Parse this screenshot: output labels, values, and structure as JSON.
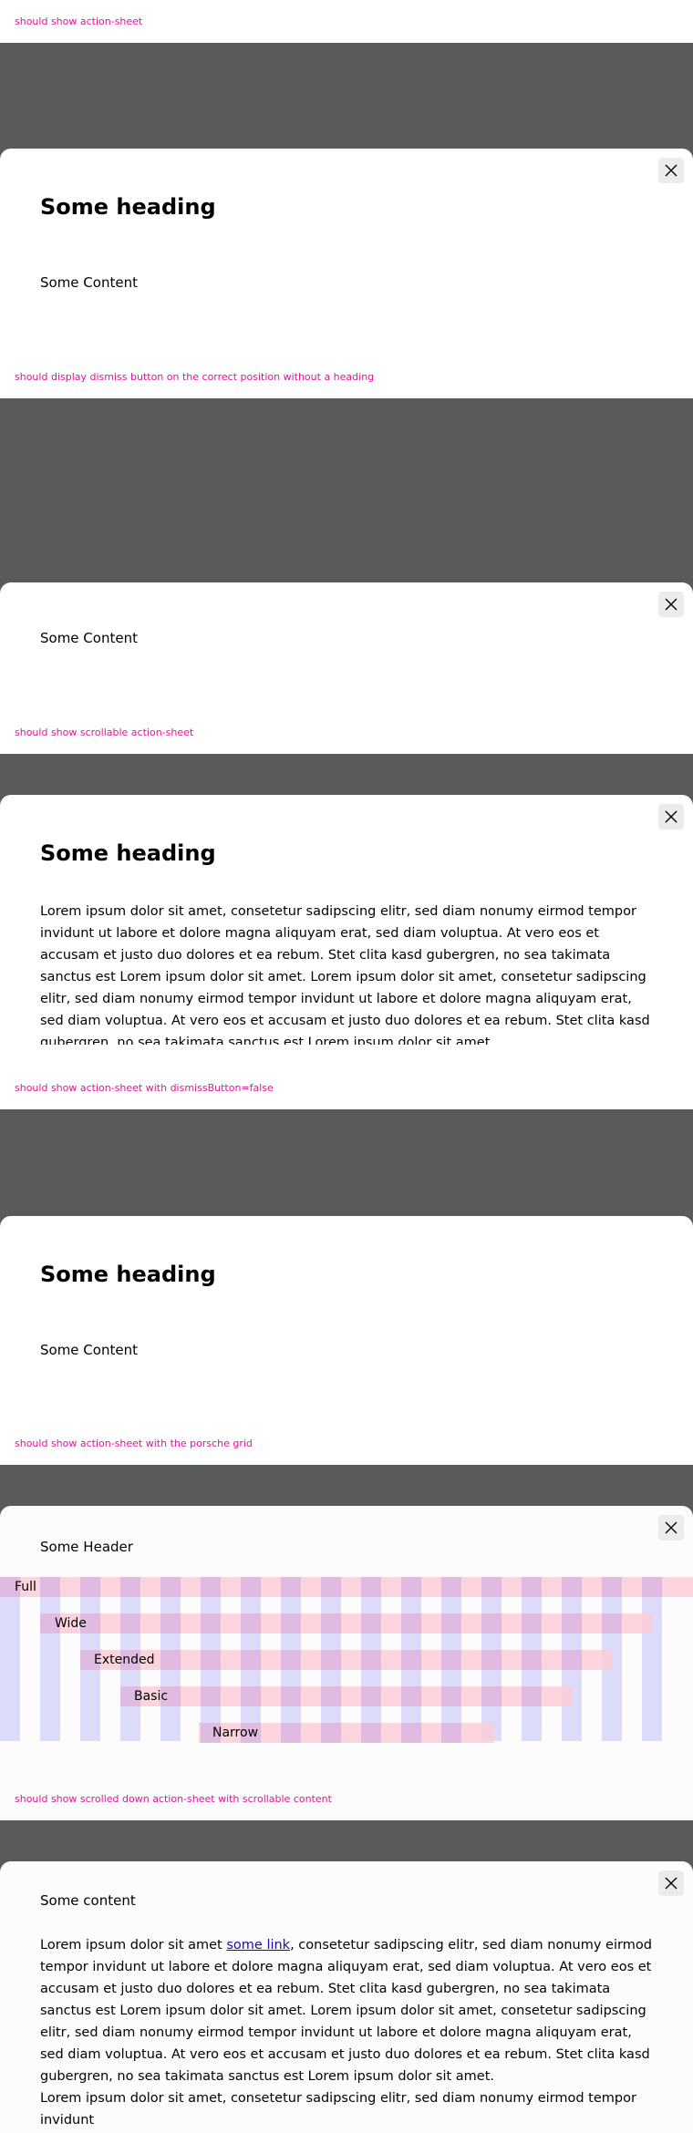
{
  "colors": {
    "label": "#e0149f",
    "backdrop": "#595a5c",
    "sheet": "#ffffff",
    "dismiss_bg": "#ebecee",
    "grid_column": "#dcdcfa",
    "grid_row": "#facdd7"
  },
  "icons": {
    "dismiss": "close-icon"
  },
  "sections": [
    {
      "label": "should show action-sheet",
      "heading": "Some heading",
      "content": "Some Content",
      "dismiss_label": "Dismiss"
    },
    {
      "label": "should display dismiss button on the correct position without a heading",
      "content": "Some Content",
      "dismiss_label": "Dismiss"
    },
    {
      "label": "should show scrollable action-sheet",
      "heading": "Some heading",
      "paragraph": "Lorem ipsum dolor sit amet, consetetur sadipscing elitr, sed diam nonumy eirmod tempor invidunt ut labore et dolore magna aliquyam erat, sed diam voluptua. At vero eos et accusam et justo duo dolores et ea rebum. Stet clita kasd gubergren, no sea takimata sanctus est Lorem ipsum dolor sit amet. Lorem ipsum dolor sit amet, consetetur sadipscing elitr, sed diam nonumy eirmod tempor invidunt ut labore et dolore magna aliquyam erat, sed diam voluptua. At vero eos et accusam et justo duo dolores et ea rebum. Stet clita kasd gubergren, no sea takimata sanctus est Lorem ipsum dolor sit amet.",
      "dismiss_label": "Dismiss"
    },
    {
      "label": "should show action-sheet with dismissButton=false",
      "heading": "Some heading",
      "content": "Some Content"
    },
    {
      "label": "should show action-sheet with the porsche grid",
      "header": "Some Header",
      "grid_rows": [
        "Full",
        "Wide",
        "Extended",
        "Basic",
        "Narrow"
      ],
      "dismiss_label": "Dismiss"
    },
    {
      "label": "should show scrolled down action-sheet with scrollable content",
      "header": "Some content",
      "para1_before": "Lorem ipsum dolor sit amet ",
      "link_text": "some link",
      "para1_after": ", consetetur sadipscing elitr, sed diam nonumy eirmod tempor invidunt ut labore et dolore magna aliquyam erat, sed diam voluptua. At vero eos et accusam et justo duo dolores et ea rebum. Stet clita kasd gubergren, no sea takimata sanctus est Lorem ipsum dolor sit amet. Lorem ipsum dolor sit amet, consetetur sadipscing elitr, sed diam nonumy eirmod tempor invidunt ut labore et dolore magna aliquyam erat, sed diam voluptua. At vero eos et accusam et justo duo dolores et ea rebum. Stet clita kasd gubergren, no sea takimata sanctus est Lorem ipsum dolor sit amet.",
      "para2": "Lorem ipsum dolor sit amet, consetetur sadipscing elitr, sed diam nonumy eirmod tempor invidunt",
      "dismiss_label": "Dismiss"
    }
  ]
}
